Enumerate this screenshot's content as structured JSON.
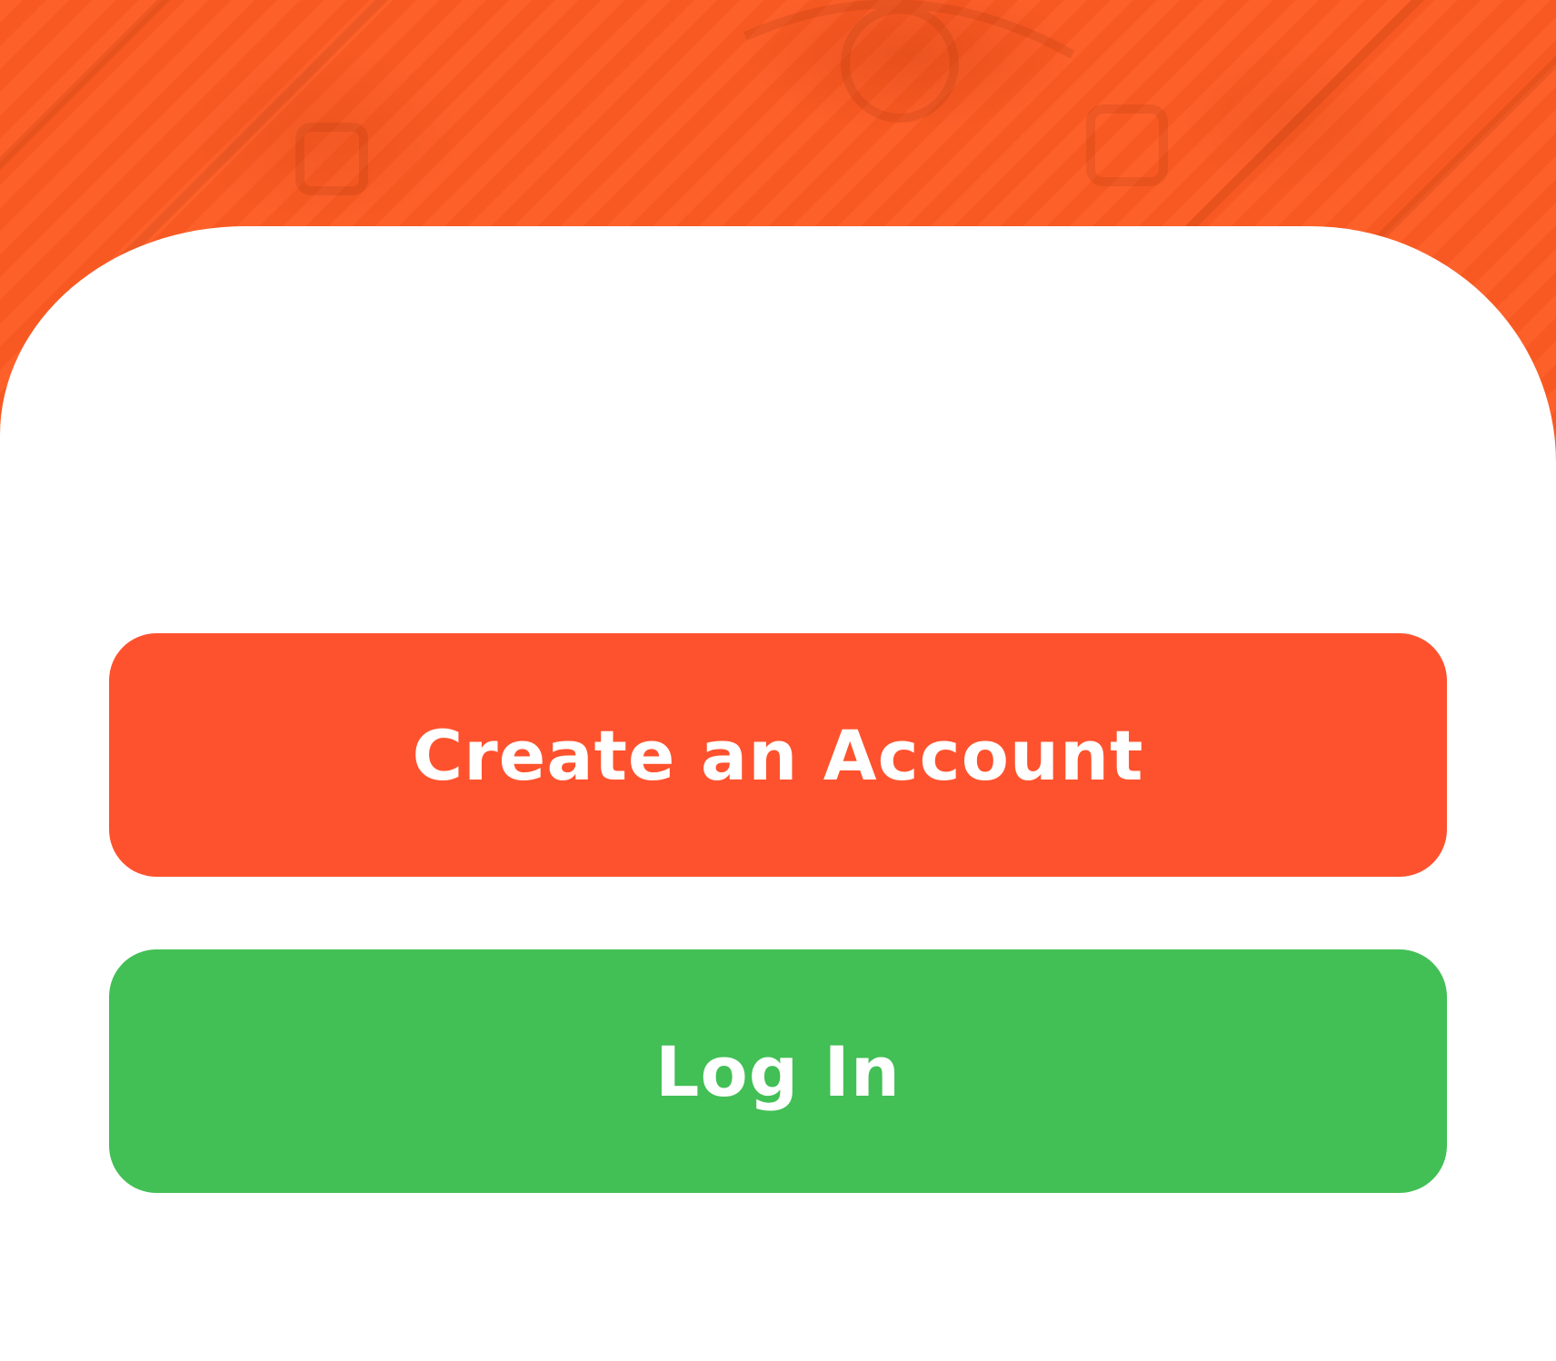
{
  "colors": {
    "header_background": "#fe5b23",
    "sheet_background": "#ffffff",
    "create_account_button": "#fe522e",
    "login_button": "#42bf55",
    "button_text": "#ffffff"
  },
  "actions": {
    "create_account_label": "Create an Account",
    "login_label": "Log In"
  }
}
